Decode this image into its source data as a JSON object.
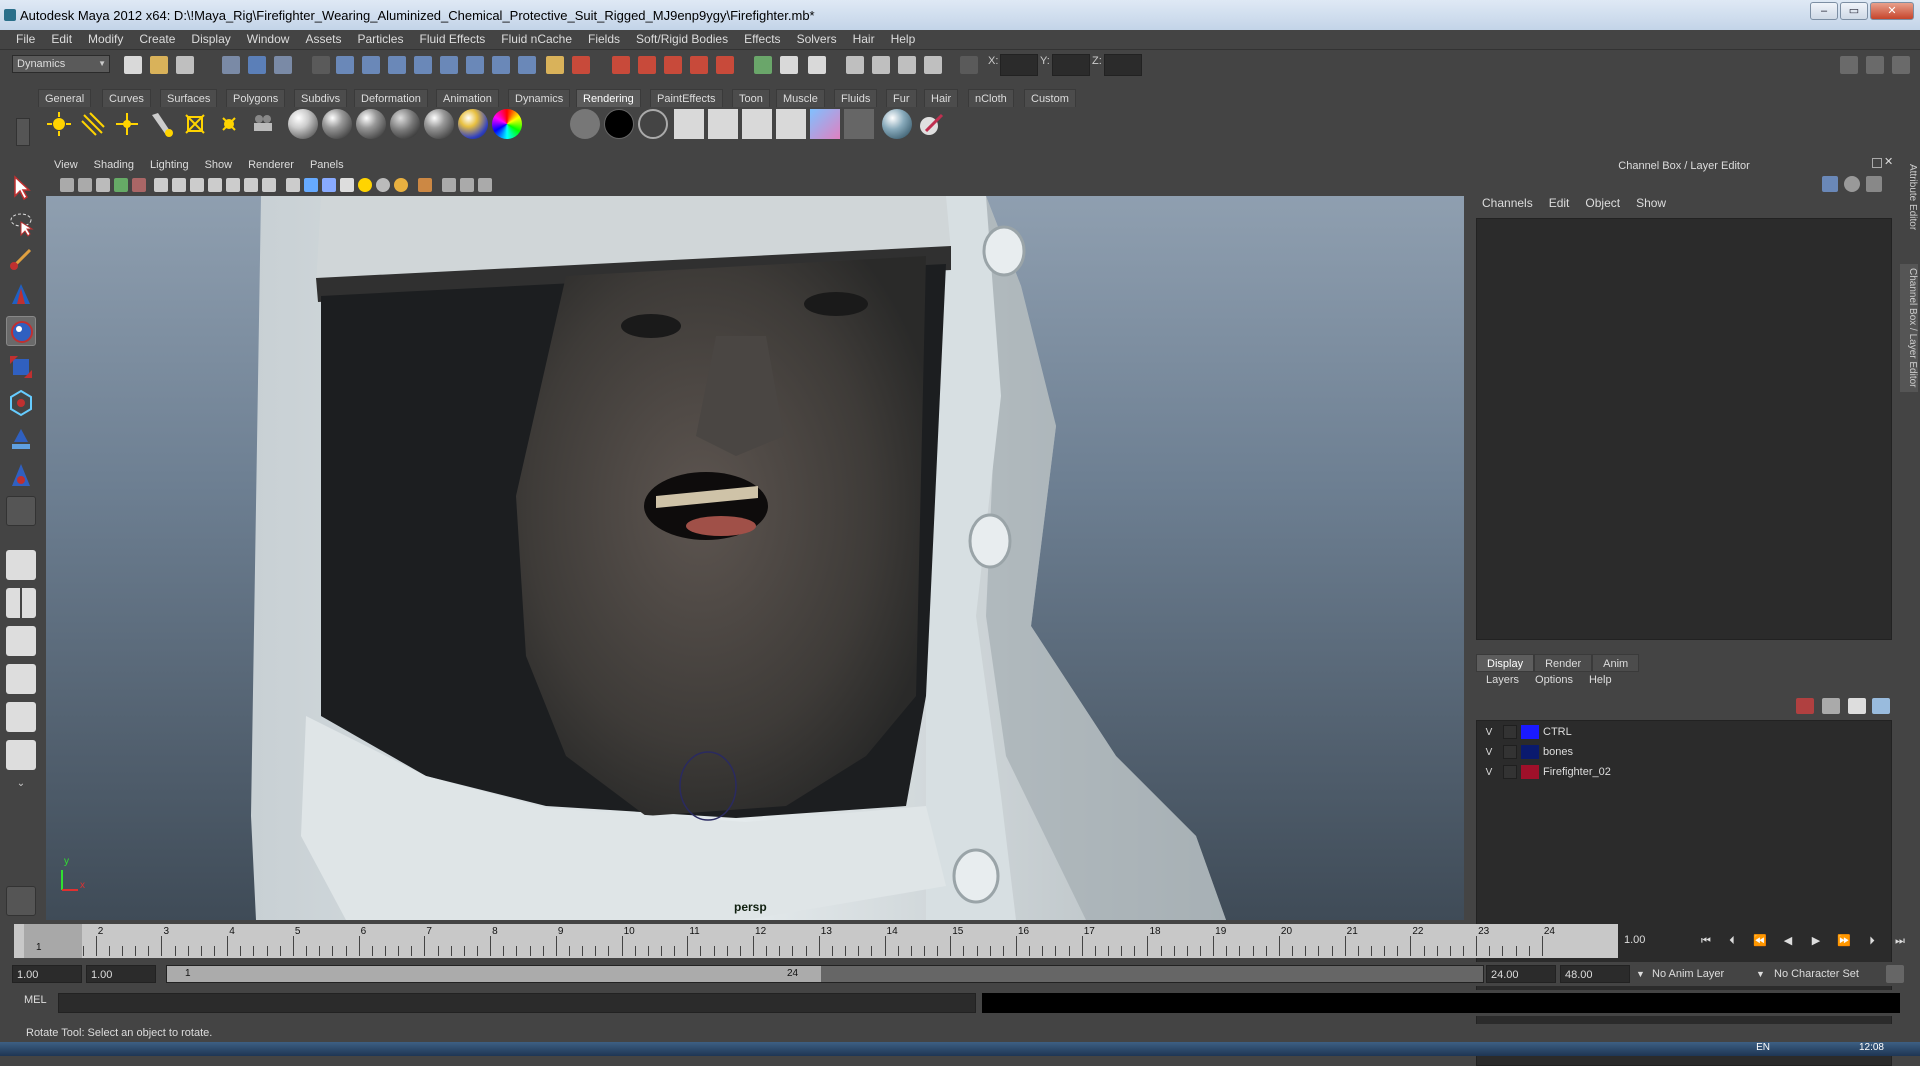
{
  "window": {
    "title": "Autodesk Maya 2012 x64: D:\\!Maya_Rig\\Firefighter_Wearing_Aluminized_Chemical_Protective_Suit_Rigged_MJ9enp9ygy\\Firefighter.mb*",
    "minimize": "0",
    "maximize": "1",
    "close": "r"
  },
  "menubar": [
    "File",
    "Edit",
    "Modify",
    "Create",
    "Display",
    "Window",
    "Assets",
    "Particles",
    "Fluid Effects",
    "Fluid nCache",
    "Fields",
    "Soft/Rigid Bodies",
    "Effects",
    "Solvers",
    "Hair",
    "Help"
  ],
  "statusline": {
    "mode": "Dynamics",
    "x_label": "X:",
    "y_label": "Y:",
    "z_label": "Z:"
  },
  "shelf": {
    "tabs": [
      "General",
      "Curves",
      "Surfaces",
      "Polygons",
      "Subdivs",
      "Deformation",
      "Animation",
      "Dynamics",
      "Rendering",
      "PaintEffects",
      "Toon",
      "Muscle",
      "Fluids",
      "Fur",
      "Hair",
      "nCloth",
      "Custom"
    ],
    "active_tab": "Rendering"
  },
  "panel": {
    "menus": [
      "View",
      "Shading",
      "Lighting",
      "Show",
      "Renderer",
      "Panels"
    ],
    "camera_label": "persp",
    "axis_y": "y",
    "axis_x": "x"
  },
  "channel_box": {
    "title": "Channel Box / Layer Editor",
    "menus": [
      "Channels",
      "Edit",
      "Object",
      "Show"
    ]
  },
  "side_tabs": [
    "Attribute Editor",
    "Channel Box / Layer Editor"
  ],
  "layer_editor": {
    "tabs": [
      "Display",
      "Render",
      "Anim"
    ],
    "active_tab": "Display",
    "menus": [
      "Layers",
      "Options",
      "Help"
    ],
    "layers": [
      {
        "visible": "V",
        "name": "CTRL",
        "color": "#1a1aff"
      },
      {
        "visible": "V",
        "name": "bones",
        "color": "#0a1a6e"
      },
      {
        "visible": "V",
        "name": "Firefighter_02",
        "color": "#a0102a"
      }
    ]
  },
  "timeline": {
    "ticks": [
      "1",
      "2",
      "3",
      "4",
      "5",
      "6",
      "7",
      "8",
      "9",
      "10",
      "11",
      "12",
      "13",
      "14",
      "15",
      "16",
      "17",
      "18",
      "19",
      "20",
      "21",
      "22",
      "23",
      "24"
    ],
    "current_frame_marker": "1",
    "current_frame": "1.00"
  },
  "range": {
    "start": "1.00",
    "playback_start": "1.00",
    "range_start_label": "1",
    "range_end_label": "24",
    "playback_end": "24.00",
    "end": "48.00",
    "anim_layer": "No Anim Layer",
    "character_set": "No Character Set"
  },
  "command": {
    "label": "MEL"
  },
  "help_line": "Rotate Tool: Select an object to rotate.",
  "taskbar": {
    "lang": "EN",
    "time": "12:08"
  }
}
